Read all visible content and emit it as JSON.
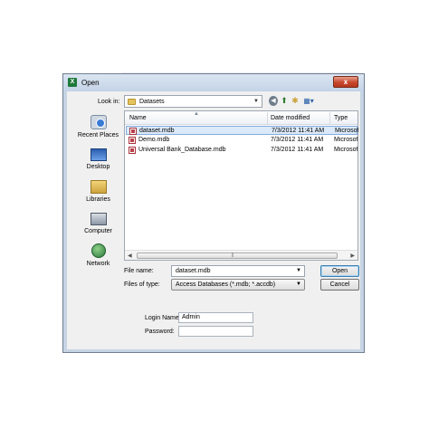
{
  "window": {
    "title": "Open",
    "app_icon": "excel-icon",
    "close_glyph": "x"
  },
  "toolbar": {
    "look_in_label": "Look in:",
    "look_in_value": "Datasets",
    "icons": [
      "back-icon",
      "up-folder-icon",
      "new-folder-icon",
      "views-menu-icon"
    ]
  },
  "places": [
    {
      "label": "Recent Places",
      "icon": "recent-places-icon"
    },
    {
      "label": "Desktop",
      "icon": "desktop-icon"
    },
    {
      "label": "Libraries",
      "icon": "libraries-icon"
    },
    {
      "label": "Computer",
      "icon": "computer-icon"
    },
    {
      "label": "Network",
      "icon": "network-icon"
    }
  ],
  "file_list": {
    "columns": [
      "Name",
      "Date modified",
      "Type"
    ],
    "rows": [
      {
        "name": "dataset.mdb",
        "date": "7/3/2012 11:41 AM",
        "type": "Microsoft",
        "selected": true
      },
      {
        "name": "Demo.mdb",
        "date": "7/3/2012 11:41 AM",
        "type": "Microsoft",
        "selected": false
      },
      {
        "name": "Universal Bank_Database.mdb",
        "date": "7/3/2012 11:41 AM",
        "type": "Microsoft",
        "selected": false
      }
    ]
  },
  "footer": {
    "file_name_label": "File name:",
    "file_name_value": "dataset.mdb",
    "file_type_label": "Files of type:",
    "file_type_value": "Access Databases (*.mdb; *.accdb)",
    "open_label": "Open",
    "cancel_label": "Cancel"
  },
  "login": {
    "login_name_label": "Login Name:",
    "login_name_value": "Admin",
    "password_label": "Password:",
    "password_value": ""
  }
}
